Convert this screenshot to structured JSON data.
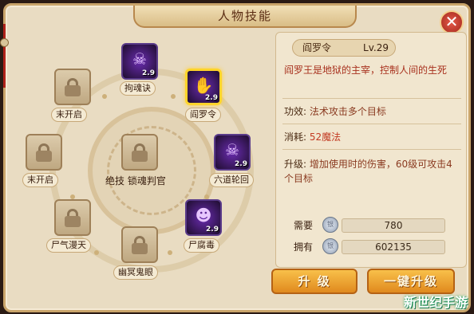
{
  "window": {
    "title": "人物技能"
  },
  "close_icon": "close-icon",
  "skills": [
    {
      "id": "gouhunjue",
      "name": "拘魂诀",
      "level": "2.9",
      "locked": false,
      "selected": false,
      "glyph": "☠"
    },
    {
      "id": "yanluoling",
      "name": "阎罗令",
      "level": "2.9",
      "locked": false,
      "selected": true,
      "glyph": "✋"
    },
    {
      "id": "liudaolunhui",
      "name": "六道轮回",
      "level": "2.9",
      "locked": false,
      "selected": false,
      "glyph": "☠"
    },
    {
      "id": "shifudu",
      "name": "尸腐毒",
      "level": "2.9",
      "locked": false,
      "selected": false,
      "glyph": "☻"
    },
    {
      "id": "youmingguiyan",
      "name": "幽冥鬼眼",
      "level": "",
      "locked": true,
      "selected": false
    },
    {
      "id": "shiqimantian",
      "name": "尸气漫天",
      "level": "",
      "locked": true,
      "selected": false
    },
    {
      "id": "unopened1",
      "name": "末开启",
      "level": "",
      "locked": true,
      "selected": false
    },
    {
      "id": "unopened2",
      "name": "末开启",
      "level": "",
      "locked": true,
      "selected": false
    }
  ],
  "center": {
    "label1": "绝技",
    "label2": "锁魂判官"
  },
  "detail": {
    "name": "阎罗令",
    "level": "Lv.29",
    "description": "阎罗王是地狱的主宰，控制人间的生死",
    "effect_label": "功效:",
    "effect_value": "法术攻击多个目标",
    "cost_label": "消耗:",
    "cost_value": "52魔法",
    "upgrade_label": "升级:",
    "upgrade_value": "增加使用时的伤害，60级可攻击4个目标"
  },
  "resources": {
    "need_label": "需要",
    "need_value": "780",
    "have_label": "拥有",
    "have_value": "602135",
    "coin_icon": "silver-coin-icon"
  },
  "buttons": {
    "upgrade": "升 级",
    "upgrade_all": "一键升级"
  },
  "watermark": "新世纪手游"
}
